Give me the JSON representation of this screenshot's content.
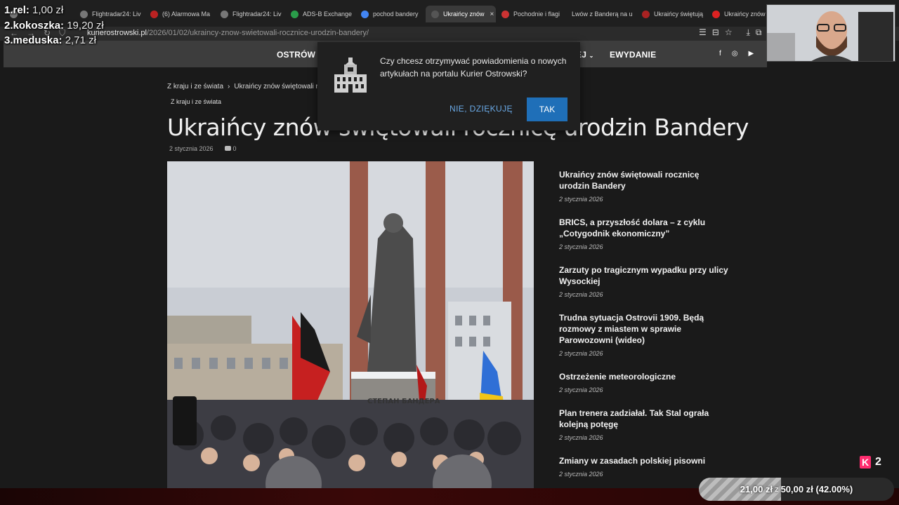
{
  "browser": {
    "tabs": [
      {
        "label": "",
        "active": false
      },
      {
        "label": "Flightradar24: Liv",
        "active": false
      },
      {
        "label": "(6) Alarmowa Ma",
        "active": false
      },
      {
        "label": "Flightradar24: Liv",
        "active": false
      },
      {
        "label": "ADS-B Exchange",
        "active": false
      },
      {
        "label": "pochod bandery",
        "active": false
      },
      {
        "label": "Ukraińcy znów",
        "active": true
      },
      {
        "label": "Pochodnie i flagi",
        "active": false
      },
      {
        "label": "Lwów z Banderą na u",
        "active": false
      },
      {
        "label": "Ukraińcy świętują",
        "active": false
      },
      {
        "label": "Ukraińcy znów ś",
        "active": false
      }
    ],
    "tab_close_glyph": "×",
    "url_domain": "kurierostrowski.pl",
    "url_path": "/2026/01/02/ukraincy-znow-swietowali-rocznice-urodzin-bandery/"
  },
  "site": {
    "nav": {
      "item1": "OSTRÓW",
      "item2_partial": "EJ",
      "item3": "EWYDANIE"
    },
    "socials": [
      "f",
      "◎",
      "▶"
    ]
  },
  "article": {
    "breadcrumb_home": "Z kraju i ze świata",
    "breadcrumb_sep": "›",
    "breadcrumb_current": "Ukraińcy znów świętowali roczi",
    "category_tag": "Z kraju i ze świata",
    "title": "Ukraińcy znów świętowali rocznicę urodzin Bandery",
    "date": "2 stycznia 2026",
    "comments": "0",
    "photo_sign": "СТЕПАН БАНДЕРА"
  },
  "sidebar": {
    "posts": [
      {
        "title": "Ukraińcy znów świętowali rocznicę urodzin Bandery",
        "date": "2 stycznia 2026"
      },
      {
        "title": "BRICS, a przyszłość dolara – z cyklu „Cotygodnik ekonomiczny”",
        "date": "2 stycznia 2026"
      },
      {
        "title": "Zarzuty po tragicznym wypadku przy ulicy Wysockiej",
        "date": "2 stycznia 2026"
      },
      {
        "title": "Trudna sytuacja Ostrovii 1909. Będą rozmowy z miastem w sprawie Parowozowni (wideo)",
        "date": "2 stycznia 2026"
      },
      {
        "title": "Ostrzeżenie meteorologiczne",
        "date": "2 stycznia 2026"
      },
      {
        "title": "Plan trenera zadziałał. Tak Stal ograła kolejną potęgę",
        "date": "2 stycznia 2026"
      },
      {
        "title": "Zmiany w zasadach polskiej pisowni",
        "date": "2 stycznia 2026"
      }
    ]
  },
  "popup": {
    "message": "Czy chcesz otrzymywać powiadomienia o nowych artykułach na portalu Kurier Ostrowski?",
    "decline_label": "NIE, DZIĘKUJĘ",
    "accept_label": "TAK"
  },
  "stream": {
    "leaderboard": [
      {
        "rank_name": "1.rel:",
        "amount": "1,00 zł"
      },
      {
        "rank_name": "2.kokoszka:",
        "amount": "19,20 zł"
      },
      {
        "rank_name": "3.meduska:",
        "amount": "2,71 zł"
      }
    ],
    "badge_letter": "K",
    "badge_count": "2",
    "goal_current": "21,00 zł",
    "goal_of": "z",
    "goal_target": "50,00 zł",
    "goal_percent_text": "(42.00%)",
    "goal_fraction": 0.42
  },
  "colors": {
    "accent": "#1f6fb8",
    "link": "#6aa9e6",
    "badge": "#ff2d6f"
  }
}
